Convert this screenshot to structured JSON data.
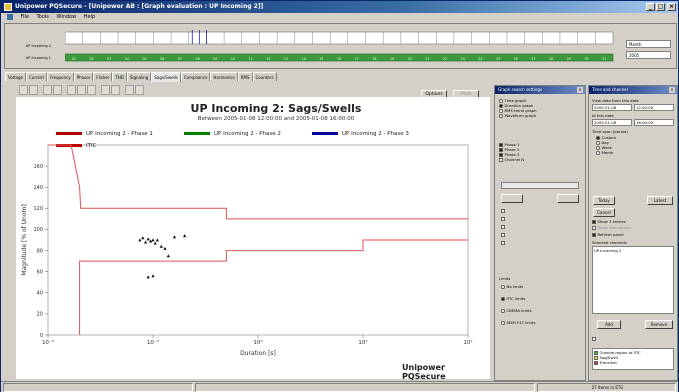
{
  "window": {
    "title": "Unipower PQSecure - [Unipower AB : [Graph evaluation : UP Incoming 2]]",
    "minimize": "_",
    "maximize": "□",
    "close": "×"
  },
  "menu": {
    "items": [
      "File",
      "Tools",
      "Window",
      "Help"
    ]
  },
  "timeline": {
    "channels": [
      "UP Incoming 2",
      "UP Incoming 1"
    ],
    "ticks": [
      "01",
      "02",
      "03",
      "04",
      "05",
      "06",
      "07",
      "08",
      "09",
      "10",
      "11",
      "12",
      "13",
      "14",
      "15",
      "16",
      "17",
      "18",
      "19",
      "20",
      "21",
      "22",
      "23",
      "24",
      "25",
      "26",
      "27",
      "28",
      "29",
      "30",
      "31"
    ],
    "view_select": "Month",
    "view_select2": "2005"
  },
  "tabs": [
    "Voltage",
    "Current",
    "Frequency",
    "Phasor",
    "Flicker",
    "THD",
    "Signaling",
    "Sags/Swells",
    "Compliance",
    "Harmonics",
    "RMS",
    "Counters"
  ],
  "active_tab": "Sags/Swells",
  "toolbar": {
    "options_label": "Options",
    "print_label": "Print"
  },
  "chart_data": {
    "type": "scatter",
    "title": "UP Incoming 2: Sags/Swells",
    "subtitle": "Between 2005-01-08 12:00:00 and 2005-01-08 16:00:00",
    "xlabel": "Duration [s]",
    "ylabel": "Magnitude [% of Unom]",
    "x_scale": "log",
    "x_ticks": [
      "10⁻²",
      "10⁻¹",
      "10⁰",
      "10¹",
      "10²"
    ],
    "x_tick_values": [
      0.01,
      0.1,
      1,
      10,
      100
    ],
    "y_ticks": [
      "0",
      "20",
      "40",
      "60",
      "80",
      "100",
      "120",
      "140",
      "160"
    ],
    "ylim": [
      0,
      180
    ],
    "xlim": [
      0.01,
      100
    ],
    "legend": [
      {
        "name": "UP Incoming 2 - Phase 1",
        "color": "#b00000"
      },
      {
        "name": "UP Incoming 2 - Phase 2",
        "color": "#008000"
      },
      {
        "name": "UP Incoming 2 - Phase 3",
        "color": "#0000a0"
      },
      {
        "name": "ITIC",
        "color": "#c00000"
      }
    ],
    "upper_limit": [
      [
        0.01,
        180
      ],
      [
        0.0166,
        180
      ],
      [
        0.02,
        140
      ],
      [
        0.0205,
        120
      ],
      [
        0.5,
        120
      ],
      [
        0.5,
        110
      ],
      [
        100,
        110
      ]
    ],
    "lower_limit": [
      [
        0.02,
        0
      ],
      [
        0.02,
        70
      ],
      [
        0.5,
        70
      ],
      [
        0.5,
        80
      ],
      [
        10,
        80
      ],
      [
        10,
        90
      ],
      [
        100,
        90
      ]
    ],
    "points": [
      {
        "x": 0.075,
        "y": 90
      },
      {
        "x": 0.08,
        "y": 92
      },
      {
        "x": 0.085,
        "y": 88
      },
      {
        "x": 0.09,
        "y": 91
      },
      {
        "x": 0.095,
        "y": 89
      },
      {
        "x": 0.1,
        "y": 90
      },
      {
        "x": 0.105,
        "y": 87
      },
      {
        "x": 0.11,
        "y": 90
      },
      {
        "x": 0.12,
        "y": 84
      },
      {
        "x": 0.13,
        "y": 82
      },
      {
        "x": 0.14,
        "y": 75
      },
      {
        "x": 0.16,
        "y": 93
      },
      {
        "x": 0.2,
        "y": 94
      },
      {
        "x": 0.09,
        "y": 55
      },
      {
        "x": 0.1,
        "y": 56
      }
    ],
    "brand": "Unipower PQSecure"
  },
  "search_panel": {
    "title": "Graph search settings",
    "graph_types": [
      "Time graph",
      "Duration graph",
      "RMS trend graph",
      "Waveform graph"
    ],
    "selected_graph": "Duration graph",
    "phases": [
      "Phase 1",
      "Phase 2",
      "Phase 3",
      "Channel N"
    ],
    "phases_checked": [
      true,
      true,
      true,
      false
    ],
    "limits_label": "Limits",
    "limits": [
      "No limits",
      "ITIC limits",
      "CBEMA limits",
      "SEMI F47 limits"
    ],
    "selected_limit": "ITIC limits"
  },
  "time_panel": {
    "title": "Time and channel",
    "from_label": "View data from this date",
    "from_date": "2005-01-08",
    "from_time": "12:00:00",
    "to_label": "to this date",
    "to_date": "2005-01-08",
    "to_time": "16:00:00",
    "period_label": "Time span (period)",
    "periods": [
      "Custom",
      "Day",
      "Week",
      "Month"
    ],
    "selected_period": "Custom",
    "today_label": "Today",
    "latest_label": "Latest",
    "cancel_label": "Cancel",
    "show_events_label": "Show 3 entries",
    "show_all_label": "Show alternatives",
    "refresh_label": "Refresh panel",
    "selected_channels_label": "Selected channels",
    "channel": "UP Incoming 2",
    "add_label": "Add",
    "remove_label": "Remove",
    "legend_items": [
      "Outside region of ITIC",
      "Sag/Swell",
      "Transient"
    ]
  },
  "status": {
    "left": "",
    "right": "27 Items in ETG"
  }
}
